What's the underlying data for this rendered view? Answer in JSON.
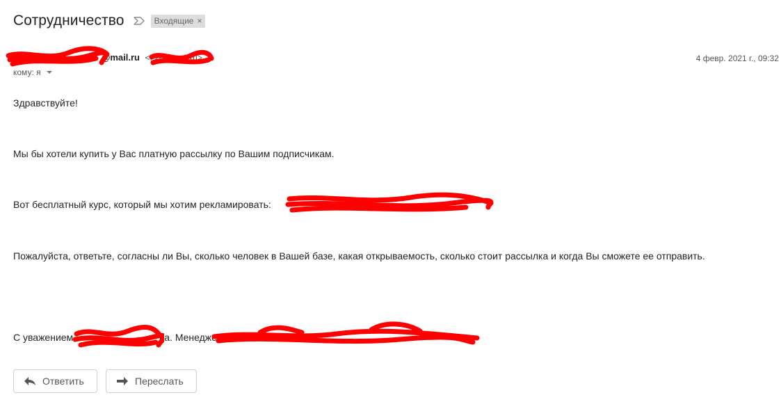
{
  "subject": "Сотрудничество",
  "label": "Входящие",
  "label_close": "×",
  "sender": {
    "name_visible": "@mail.ru",
    "email_visible": "<f 20@mail.ru>"
  },
  "date": "4 февр. 2021 г., 09:32",
  "to": "кому: я",
  "body": {
    "greeting": "Здравствуйте!",
    "line1": "Мы бы хотели купить у Вас платную рассылку по Вашим подписчикам.",
    "line2": "Вот бесплатный курс, который мы хотим рекламировать:",
    "line3": "Пожалуйста, ответьте, согласны ли Вы, сколько человек в Вашей базе, какая открываемость, сколько стоит рассылка и когда Вы сможете ее отправить.",
    "sign_prefix": "С уважением,",
    "sign_middle": "ва. Менеджер"
  },
  "actions": {
    "reply": "Ответить",
    "forward": "Переслать"
  },
  "colors": {
    "redaction": "#ff0000",
    "chip_bg": "#dddddd"
  },
  "icons": {
    "importance": "importance-marker-icon",
    "reply": "reply-arrow-icon",
    "forward": "forward-arrow-icon"
  }
}
